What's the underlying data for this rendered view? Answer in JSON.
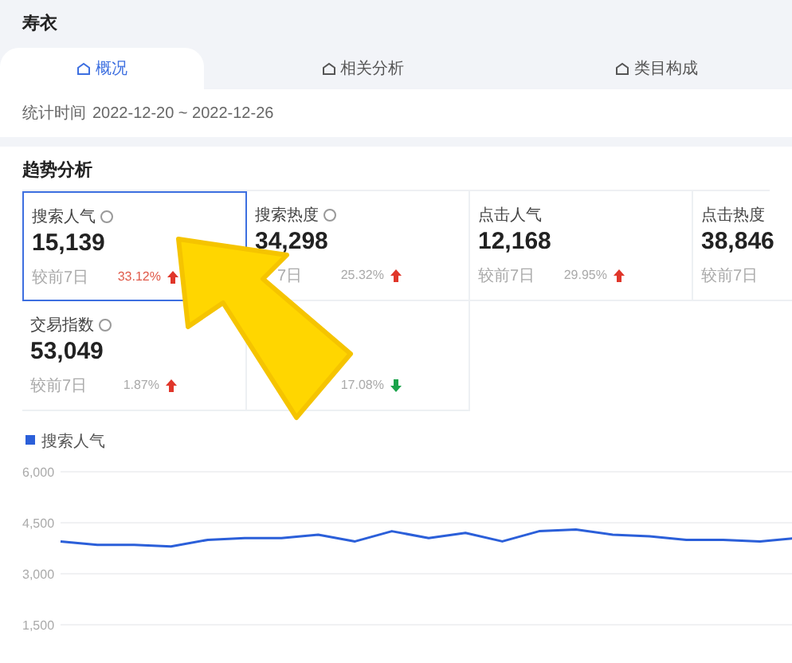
{
  "page_title": "寿衣",
  "tabs": [
    {
      "label": "概况",
      "selected": true
    },
    {
      "label": "相关分析",
      "selected": false
    },
    {
      "label": "类目构成",
      "selected": false
    }
  ],
  "date_range": {
    "label": "统计时间",
    "value": "2022-12-20 ~ 2022-12-26"
  },
  "section_title": "趋势分析",
  "metrics": [
    {
      "title": "搜索人气",
      "has_help": true,
      "value": "15,139",
      "compare_label": "较前7日",
      "change": "33.12%",
      "rising": true,
      "selected": true
    },
    {
      "title": "搜索热度",
      "has_help": true,
      "value": "34,298",
      "compare_label": "7日",
      "change": "25.32%",
      "rising": true,
      "selected": false
    },
    {
      "title": "点击人气",
      "has_help": false,
      "value": "12,168",
      "compare_label": "较前7日",
      "change": "29.95%",
      "rising": true,
      "selected": false
    },
    {
      "title": "点击热度",
      "has_help": false,
      "value": "38,846",
      "compare_label": "较前7日",
      "selected": false
    },
    {
      "title": "交易指数",
      "has_help": true,
      "value": "53,049",
      "compare_label": "较前7日",
      "change": "1.87%",
      "rising": true,
      "selected": false
    },
    {
      "change": "17.08%",
      "rising": false,
      "selected": false
    }
  ],
  "chart": {
    "chart_data": {
      "type": "line",
      "series": [
        {
          "name": "搜索人气",
          "color": "#2b5fd9",
          "values": [
            3950,
            3850,
            3850,
            3800,
            4000,
            4050,
            4050,
            4150,
            3950,
            4250,
            4050,
            4200,
            3950,
            4250,
            4300,
            4150,
            4100,
            4000,
            4000,
            3950,
            4050
          ]
        }
      ],
      "grid": true,
      "ylim": [
        1500,
        6000
      ],
      "yticks": [
        {
          "value": 6000,
          "label": "6,000"
        },
        {
          "value": 4500,
          "label": "4,500"
        },
        {
          "value": 3000,
          "label": "3,000"
        },
        {
          "value": 1500,
          "label": "1,500"
        }
      ]
    }
  }
}
